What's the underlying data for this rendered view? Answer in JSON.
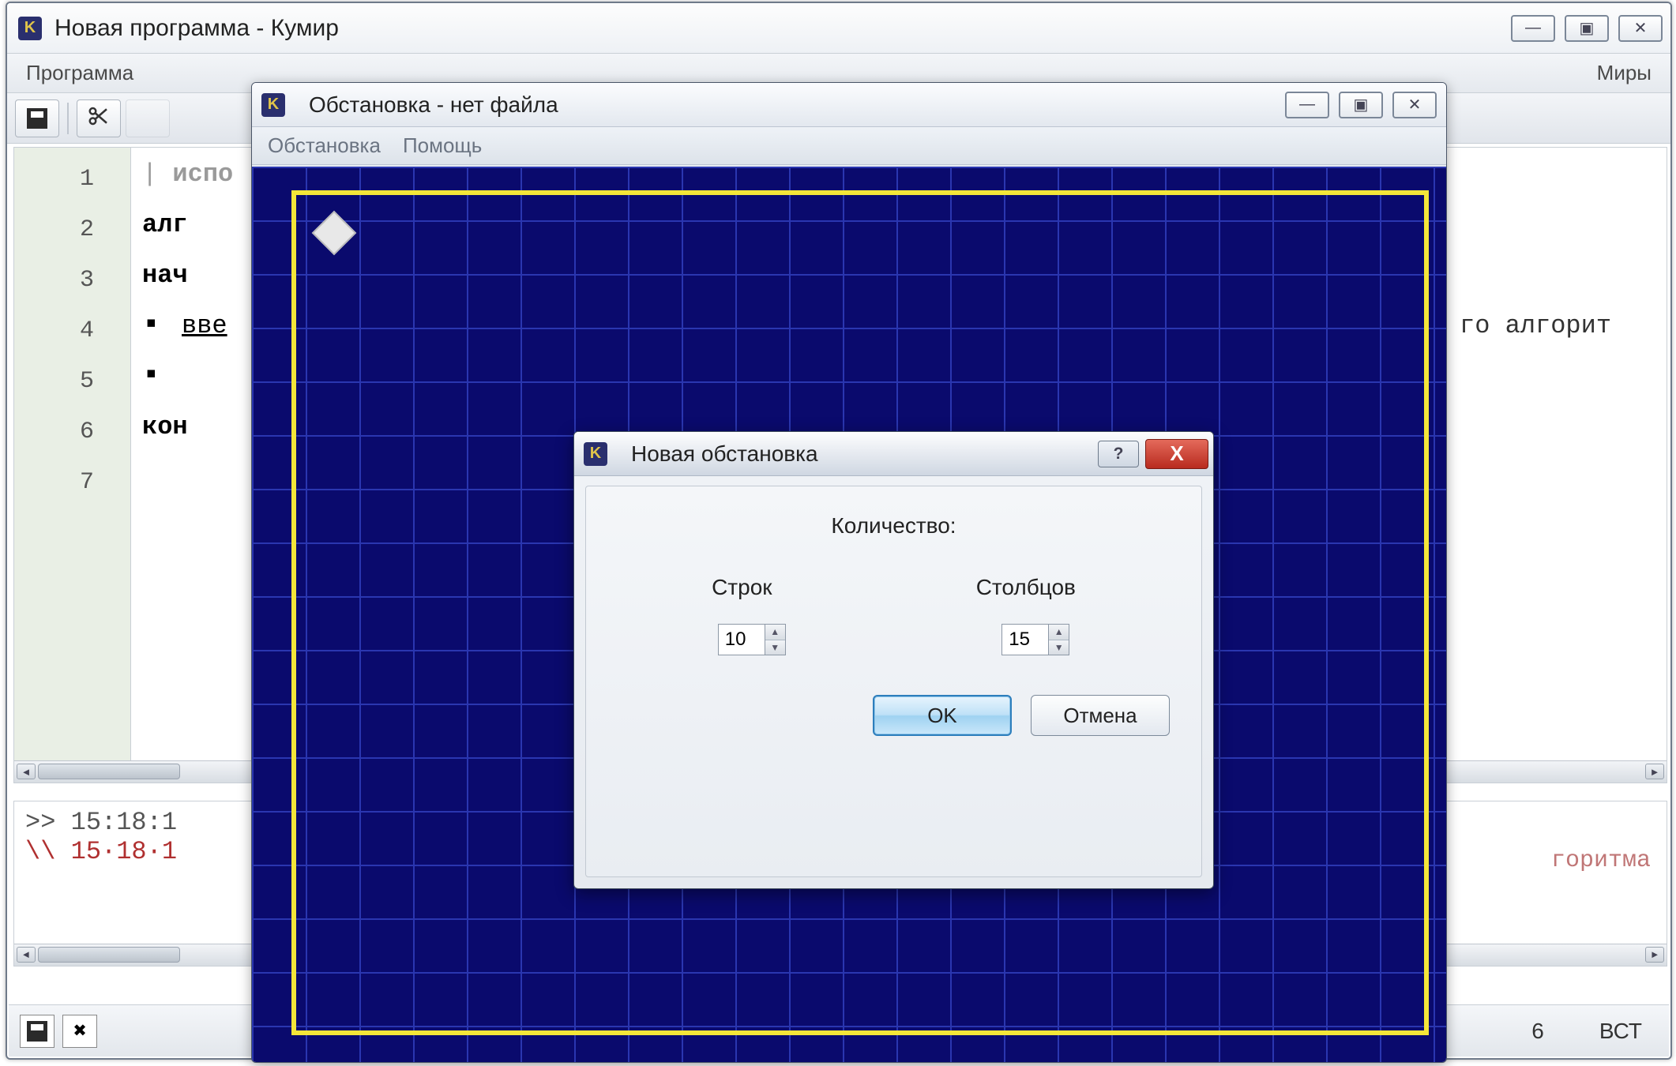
{
  "main_window": {
    "title": "Новая программа - Кумир",
    "menubar": {
      "program": "Программа",
      "worlds": "Миры"
    }
  },
  "editor": {
    "lines": [
      "1",
      "2",
      "3",
      "4",
      "5",
      "6",
      "7"
    ],
    "code": {
      "l1": "испо",
      "l2": "алг",
      "l3": "нач",
      "l4": "вве",
      "l5": "",
      "l6": "кон",
      "l7": "",
      "right_fragment": "го алгорит"
    }
  },
  "console": {
    "line1": ">> 15:18:1",
    "line2": "\\\\ 15·18·1",
    "right_fragment": "горитма"
  },
  "statusbar": {
    "val1": "6",
    "val2": "ВСТ"
  },
  "env_window": {
    "title": "Обстановка - нет файла",
    "menubar": {
      "env": "Обстановка",
      "help": "Помощь"
    }
  },
  "dialog": {
    "title": "Новая обстановка",
    "count_label": "Количество:",
    "rows_label": "Строк",
    "cols_label": "Столбцов",
    "rows_value": "10",
    "cols_value": "15",
    "ok": "OK",
    "cancel": "Отмена",
    "help_char": "?",
    "close_char": "X"
  },
  "icons": {
    "app": "K"
  },
  "win_glyphs": {
    "min": "—",
    "max": "▣",
    "close": "✕"
  }
}
